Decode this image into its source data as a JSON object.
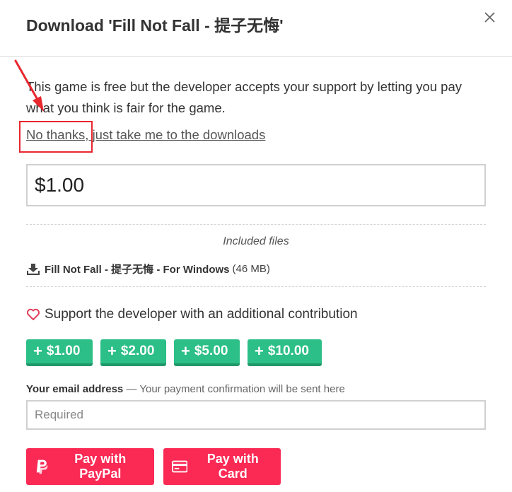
{
  "dialog": {
    "title": "Download 'Fill Not Fall - 提子无悔'",
    "close_icon": "close-icon"
  },
  "intro": {
    "text": "This game is free but the developer accepts your support by letting you pay what you think is fair for the game.",
    "no_thanks_link": "No thanks, just take me to the downloads"
  },
  "price": {
    "value": "$1.00"
  },
  "files": {
    "heading": "Included files",
    "items": [
      {
        "icon": "download-icon",
        "name": "Fill Not Fall - 提子无悔 - For Windows",
        "size": "(46 MB)"
      }
    ]
  },
  "support": {
    "icon": "heart-icon",
    "text": "Support the developer with an additional contribution",
    "buttons": [
      {
        "plus": "+",
        "label": "$1.00"
      },
      {
        "plus": "+",
        "label": "$2.00"
      },
      {
        "plus": "+",
        "label": "$5.00"
      },
      {
        "plus": "+",
        "label": "$10.00"
      }
    ]
  },
  "email": {
    "label": "Your email address",
    "hint": " — Your payment confirmation will be sent here",
    "placeholder": "Required",
    "value": ""
  },
  "payment": {
    "paypal_label": "Pay with PayPal",
    "paypal_icon": "paypal-icon",
    "card_label": "Pay with Card",
    "card_icon": "credit-card-icon"
  },
  "colors": {
    "contribution_green": "#2cbf87",
    "pay_red": "#fa2a55",
    "annotation_red": "#e8272f"
  }
}
